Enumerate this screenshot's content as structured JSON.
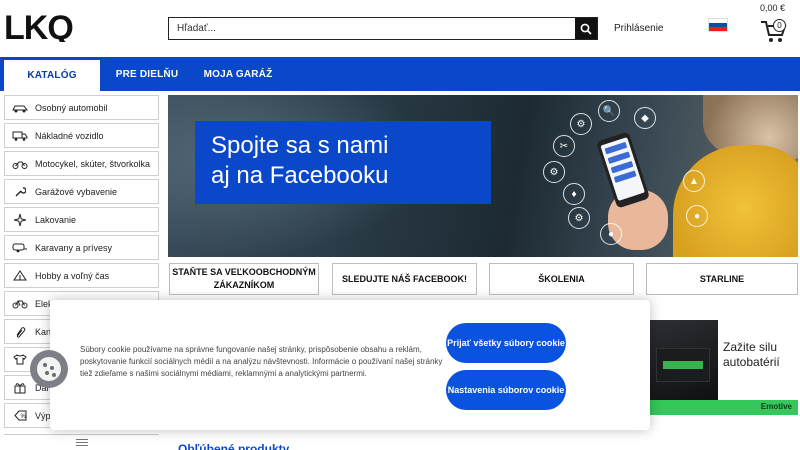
{
  "header": {
    "logo_text": "LKQ",
    "search_placeholder": "Hľadať...",
    "login_label": "Prihlásenie",
    "cart_total": "0,00 €",
    "cart_count": "0"
  },
  "nav": {
    "items": [
      "KATALÓG",
      "PRE DIELŇU",
      "MOJA GARÁŽ"
    ]
  },
  "sidebar": {
    "items": [
      {
        "label": "Osobný automobil",
        "icon": "car-icon"
      },
      {
        "label": "Nákladné vozidlo",
        "icon": "truck-icon"
      },
      {
        "label": "Motocykel, skúter, štvorkolka",
        "icon": "motorcycle-icon"
      },
      {
        "label": "Garážové vybavenie",
        "icon": "wrench-icon"
      },
      {
        "label": "Lakovanie",
        "icon": "sparkle-icon"
      },
      {
        "label": "Karavany a prívesy",
        "icon": "caravan-icon"
      },
      {
        "label": "Hobby a voľný čas",
        "icon": "tent-icon"
      },
      {
        "label": "Elek",
        "icon": "bicycle-icon"
      },
      {
        "label": "Kanc",
        "icon": "paperclip-icon"
      },
      {
        "label": "",
        "icon": "tshirt-icon"
      },
      {
        "label": "Darč",
        "icon": "gift-icon"
      },
      {
        "label": "Výpr",
        "icon": "tag-icon"
      }
    ]
  },
  "banner": {
    "line1": "Spojte sa s nami",
    "line2": "aj na Facebooku"
  },
  "quick_links": [
    "STAŇTE SA VEĽKOOBCHODNÝM ZÁKAZNÍKOM",
    "SLEDUJTE NÁŠ FACEBOOK!",
    "ŠKOLENIA",
    "STARLINE"
  ],
  "ad": {
    "line1": "Zažite silu",
    "line2": "autobatérií",
    "brand": "Emotive"
  },
  "popular_heading": "Obľúbené produkty",
  "cookie": {
    "text": "Súbory cookie používame na správne fungovanie našej stránky, prispôsobenie obsahu a reklám, poskytovanie funkcií sociálnych médií a na analýzu návštevnosti. Informácie o používaní našej stránky tiež zdieľame s našimi sociálnymi médiami, reklamnými a analytickými partnermi.",
    "accept_label": "Prijať všetky súbory cookie",
    "settings_label": "Nastavenia súborov cookie"
  },
  "colors": {
    "brand_blue": "#0a47c9",
    "button_blue": "#0a52e0",
    "ad_green": "#34c759"
  }
}
